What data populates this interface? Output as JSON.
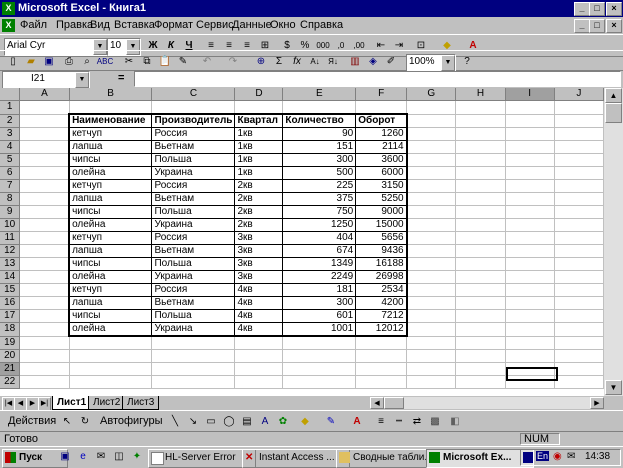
{
  "window": {
    "title": "Microsoft Excel - Книга1"
  },
  "menu": [
    "Файл",
    "Правка",
    "Вид",
    "Вставка",
    "Формат",
    "Сервис",
    "Данные",
    "Окно",
    "Справка"
  ],
  "format_toolbar": {
    "font": "Arial Cyr",
    "size": "10",
    "bold": "Ж",
    "italic": "К",
    "underline": "Ч"
  },
  "std_toolbar": {
    "zoom": "100%"
  },
  "formula_bar": {
    "name_box": "I21",
    "equals": "="
  },
  "columns": [
    "A",
    "B",
    "C",
    "D",
    "E",
    "F",
    "G",
    "H",
    "I",
    "J"
  ],
  "headers": [
    "Наименование",
    "Производитель",
    "Квартал",
    "Количество",
    "Оборот"
  ],
  "rows": [
    [
      "кетчуп",
      "Россия",
      "1кв",
      "90",
      "1260"
    ],
    [
      "лапша",
      "Вьетнам",
      "1кв",
      "151",
      "2114"
    ],
    [
      "чипсы",
      "Польша",
      "1кв",
      "300",
      "3600"
    ],
    [
      "олейна",
      "Украина",
      "1кв",
      "500",
      "6000"
    ],
    [
      "кетчуп",
      "Россия",
      "2кв",
      "225",
      "3150"
    ],
    [
      "лапша",
      "Вьетнам",
      "2кв",
      "375",
      "5250"
    ],
    [
      "чипсы",
      "Польша",
      "2кв",
      "750",
      "9000"
    ],
    [
      "олейна",
      "Украина",
      "2кв",
      "1250",
      "15000"
    ],
    [
      "кетчуп",
      "Россия",
      "3кв",
      "404",
      "5656"
    ],
    [
      "лапша",
      "Вьетнам",
      "3кв",
      "674",
      "9436"
    ],
    [
      "чипсы",
      "Польша",
      "3кв",
      "1349",
      "16188"
    ],
    [
      "олейна",
      "Украина",
      "3кв",
      "2249",
      "26998"
    ],
    [
      "кетчуп",
      "Россия",
      "4кв",
      "181",
      "2534"
    ],
    [
      "лапша",
      "Вьетнам",
      "4кв",
      "300",
      "4200"
    ],
    [
      "чипсы",
      "Польша",
      "4кв",
      "601",
      "7212"
    ],
    [
      "олейна",
      "Украина",
      "4кв",
      "1001",
      "12012"
    ]
  ],
  "sheet_tabs": [
    "Лист1",
    "Лист2",
    "Лист3"
  ],
  "draw_toolbar": {
    "actions": "Действия",
    "autoshapes": "Автофигуры"
  },
  "status": {
    "ready": "Готово",
    "num": "NUM"
  },
  "taskbar": {
    "start": "Пуск",
    "tasks": [
      "HL-Server Error",
      "Instant Access ...",
      "Сводные табли...",
      "Microsoft Ex..."
    ],
    "lang": "En",
    "clock": "14:38"
  }
}
